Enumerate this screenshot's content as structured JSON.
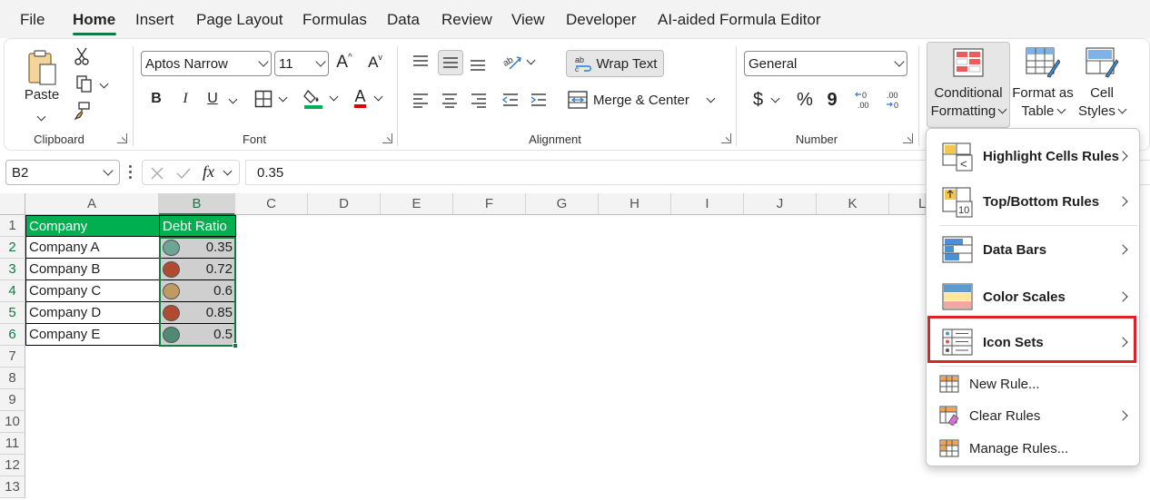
{
  "menu_tabs": [
    "File",
    "Home",
    "Insert",
    "Page Layout",
    "Formulas",
    "Data",
    "Review",
    "View",
    "Developer",
    "AI-aided Formula Editor"
  ],
  "active_tab": "Home",
  "clipboard": {
    "paste_label": "Paste",
    "group_label": "Clipboard"
  },
  "font": {
    "family": "Aptos Narrow",
    "size": "11",
    "group_label": "Font",
    "bold": "B",
    "italic": "I",
    "underline": "U",
    "grow": "A",
    "shrink": "A",
    "font_color": "A"
  },
  "alignment": {
    "wrap_text": "Wrap Text",
    "merge_center": "Merge & Center",
    "group_label": "Alignment"
  },
  "number": {
    "format": "General",
    "currency": "$",
    "percent": "%",
    "comma": "9",
    "inc_decimal": "←0\n.00",
    "dec_decimal": ".00\n→0",
    "group_label": "Number"
  },
  "styles": {
    "cf_line1": "Conditional",
    "cf_line2": "Formatting",
    "fat_line1": "Format as",
    "fat_line2": "Table",
    "cs_line1": "Cell",
    "cs_line2": "Styles"
  },
  "formula_bar": {
    "name_box": "B2",
    "value": "0.35",
    "fx": "fx"
  },
  "columns": [
    "A",
    "B",
    "C",
    "D",
    "E",
    "F",
    "G",
    "H",
    "I",
    "J",
    "K",
    "L"
  ],
  "rows": [
    "1",
    "2",
    "3",
    "4",
    "5",
    "6",
    "7",
    "8",
    "9",
    "10",
    "11",
    "12",
    "13"
  ],
  "table": {
    "headers": [
      "Company",
      "Debt Ratio"
    ],
    "rows": [
      {
        "company": "Company A",
        "ratio": "0.35",
        "color": "#6aa595"
      },
      {
        "company": "Company B",
        "ratio": "0.72",
        "color": "#b04a30"
      },
      {
        "company": "Company C",
        "ratio": "0.6",
        "color": "#c09a63"
      },
      {
        "company": "Company D",
        "ratio": "0.85",
        "color": "#b04a30"
      },
      {
        "company": "Company E",
        "ratio": "0.5",
        "color": "#4f8a72"
      }
    ]
  },
  "cf_menu": {
    "items": [
      {
        "label": "Highlight Cells Rules",
        "icon": "highlight-cells-icon"
      },
      {
        "label": "Top/Bottom Rules",
        "icon": "top-bottom-icon"
      },
      {
        "label": "Data Bars",
        "icon": "data-bars-icon"
      },
      {
        "label": "Color Scales",
        "icon": "color-scales-icon"
      },
      {
        "label": "Icon Sets",
        "icon": "icon-sets-icon"
      }
    ],
    "actions": [
      {
        "label": "New Rule...",
        "icon": "new-rule-icon"
      },
      {
        "label": "Clear Rules",
        "icon": "clear-rules-icon"
      },
      {
        "label": "Manage Rules...",
        "icon": "manage-rules-icon"
      }
    ]
  },
  "accent_color": "#107c41",
  "highlight_color": "#e0202a"
}
